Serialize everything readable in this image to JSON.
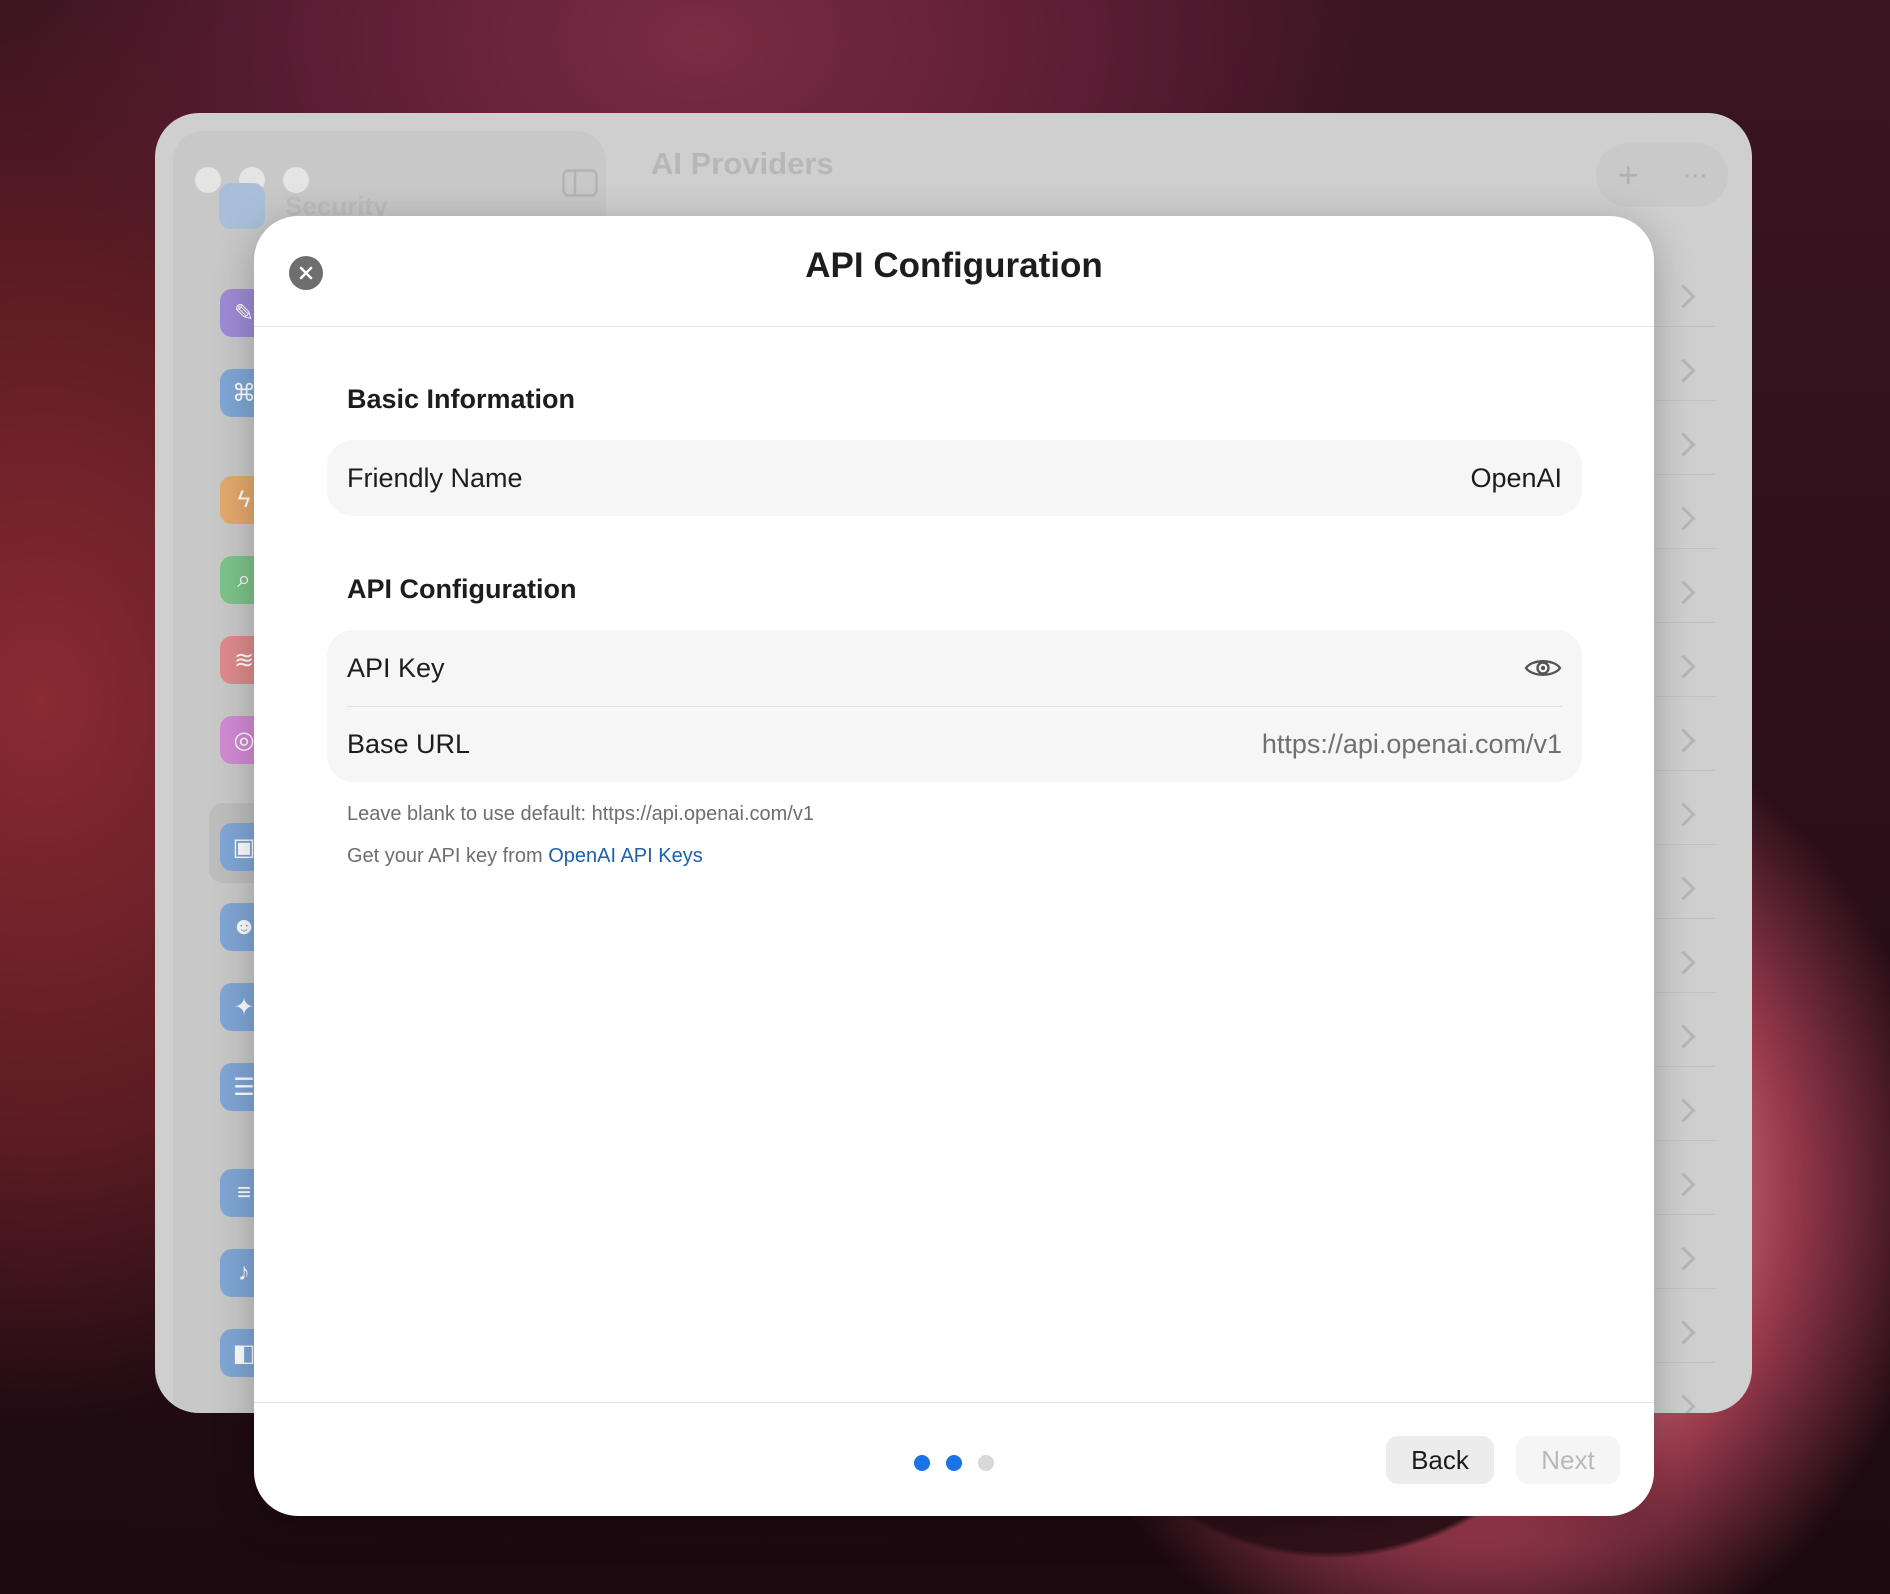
{
  "background_window": {
    "title": "AI Providers",
    "sidebar_ghost_label": "Security",
    "toolbar_add_glyph": "+",
    "toolbar_more_glyph": "···",
    "sidebar_icons": [
      {
        "name": "paintbrush-icon",
        "color": "#9d8ad6"
      },
      {
        "name": "command-icon",
        "color": "#7fa6d6"
      },
      {
        "name": "bolt-icon",
        "color": "#e3a86c"
      },
      {
        "name": "magnifier-icon",
        "color": "#7cc28a"
      },
      {
        "name": "waveform-icon",
        "color": "#dd8a8a"
      },
      {
        "name": "camera-scan-icon",
        "color": "#d08ad3"
      },
      {
        "name": "chip-icon",
        "color": "#7fa6d6"
      },
      {
        "name": "people-icon",
        "color": "#7fa6d6"
      },
      {
        "name": "magic-wand-icon",
        "color": "#7fa6d6"
      },
      {
        "name": "quote-text-icon",
        "color": "#7fa6d6"
      },
      {
        "name": "sliders-icon",
        "color": "#7fa6d6"
      },
      {
        "name": "microphone-icon",
        "color": "#7fa6d6"
      },
      {
        "name": "puzzle-icon",
        "color": "#7fa6d6"
      }
    ]
  },
  "modal": {
    "title": "API Configuration",
    "basic_section": {
      "title": "Basic Information",
      "friendly_name_label": "Friendly Name",
      "friendly_name_value": "OpenAI"
    },
    "api_section": {
      "title": "API Configuration",
      "api_key_label": "API Key",
      "base_url_label": "Base URL",
      "base_url_value": "https://api.openai.com/v1"
    },
    "hint_default": "Leave blank to use default: https://api.openai.com/v1",
    "hint_key_prefix": "Get your API key from ",
    "hint_key_link": "OpenAI API Keys",
    "footer": {
      "step_dots": [
        {
          "state": "active",
          "color": "#1a73e8"
        },
        {
          "state": "active",
          "color": "#1a73e8"
        },
        {
          "state": "inactive",
          "color": "#d8d8d8"
        }
      ],
      "back_label": "Back",
      "next_label": "Next"
    }
  },
  "colors": {
    "accent": "#1a73e8",
    "link": "#1c5fb5"
  }
}
